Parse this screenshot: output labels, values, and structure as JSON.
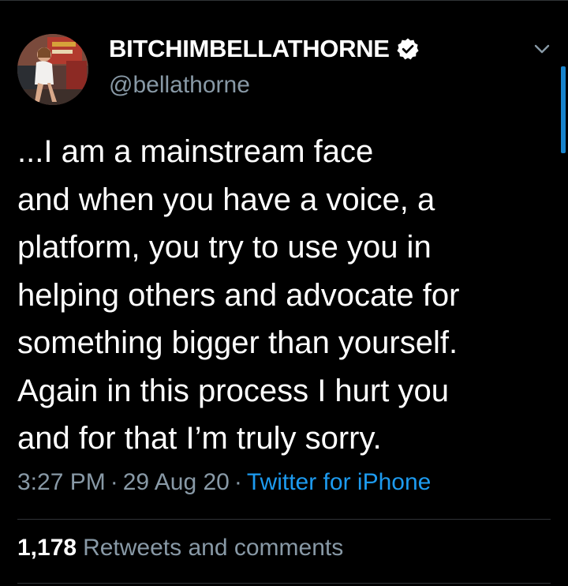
{
  "tweet": {
    "author": {
      "display_name": "BITCHIMBELLATHORNE",
      "handle": "@bellathorne",
      "verified": true,
      "verified_icon": "verified-badge-icon"
    },
    "text_lines": [
      "...I am a mainstream face",
      "and when you have a voice, a",
      "platform, you try to use you in",
      "helping others and advocate for",
      "something bigger than yourself.",
      "Again in this process I hurt you",
      "and for that I’m truly sorry."
    ],
    "time": "3:27 PM",
    "separator": "·",
    "date": "29 Aug 20",
    "source": "Twitter for iPhone",
    "stats": {
      "retweets_count": "1,178",
      "retweets_label": "Retweets and comments"
    },
    "menu_icon": "chevron-down-icon"
  },
  "colors": {
    "background": "#000000",
    "text": "#ffffff",
    "secondary_text": "#8899a6",
    "accent": "#1d9bf0",
    "divider": "#2f3336"
  }
}
